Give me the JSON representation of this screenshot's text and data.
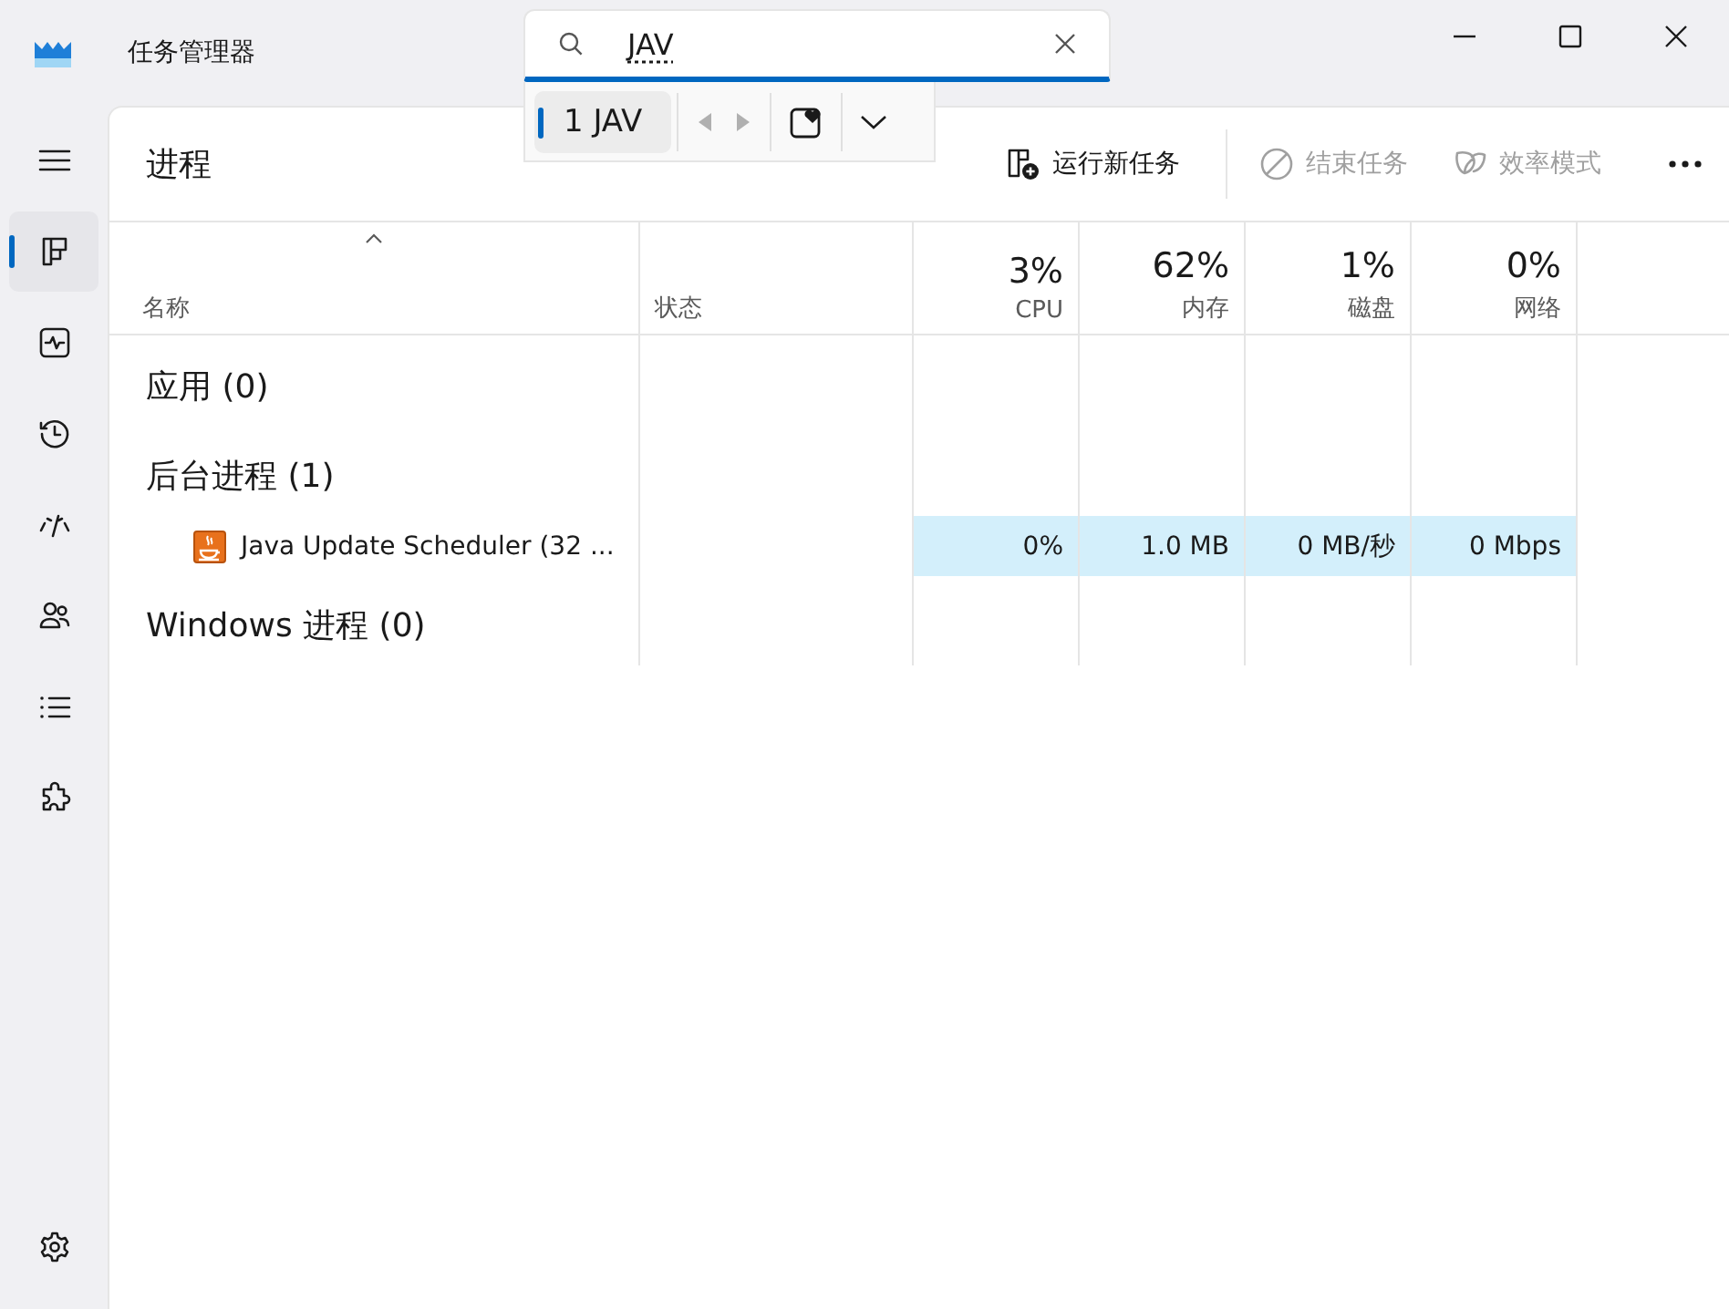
{
  "window": {
    "title": "任务管理器"
  },
  "search": {
    "value": "JAV",
    "suggestions": [
      {
        "label": "1 JAV",
        "selected": true
      }
    ],
    "previous_disabled": true,
    "next_disabled": true
  },
  "nav": {
    "items": [
      {
        "kind": "menu",
        "selected": false
      },
      {
        "kind": "processes",
        "selected": true
      },
      {
        "kind": "performance",
        "selected": false
      },
      {
        "kind": "history",
        "selected": false
      },
      {
        "kind": "startup",
        "selected": false
      },
      {
        "kind": "users",
        "selected": false
      },
      {
        "kind": "details",
        "selected": false
      },
      {
        "kind": "services",
        "selected": false
      }
    ],
    "footer": {
      "kind": "settings",
      "selected": false
    }
  },
  "page": {
    "title": "进程"
  },
  "toolbar": {
    "buttons": [
      {
        "kind": "run",
        "label": "运行新任务",
        "disabled": false
      },
      {
        "kind": "end",
        "label": "结束任务",
        "disabled": true
      },
      {
        "kind": "efficiency",
        "label": "效率模式",
        "disabled": true
      }
    ]
  },
  "table": {
    "columns": [
      {
        "label": "名称",
        "sorted": true
      },
      {
        "label": "状态",
        "sorted": false
      },
      {
        "usage": "3%",
        "label": "CPU",
        "sorted": false
      },
      {
        "usage": "62%",
        "label": "内存",
        "sorted": false
      },
      {
        "usage": "1%",
        "label": "磁盘",
        "sorted": false
      },
      {
        "usage": "0%",
        "label": "网络",
        "sorted": false
      }
    ],
    "groups": [
      {
        "title": "应用 (0)"
      },
      {
        "title": "后台进程 (1)",
        "rows": [
          {
            "name": "Java Update Scheduler (32 ...",
            "cpu": "0%",
            "memory": "1.0 MB",
            "disk": "0 MB/秒",
            "network": "0 Mbps"
          }
        ]
      },
      {
        "title": "Windows 进程 (0)"
      }
    ]
  }
}
